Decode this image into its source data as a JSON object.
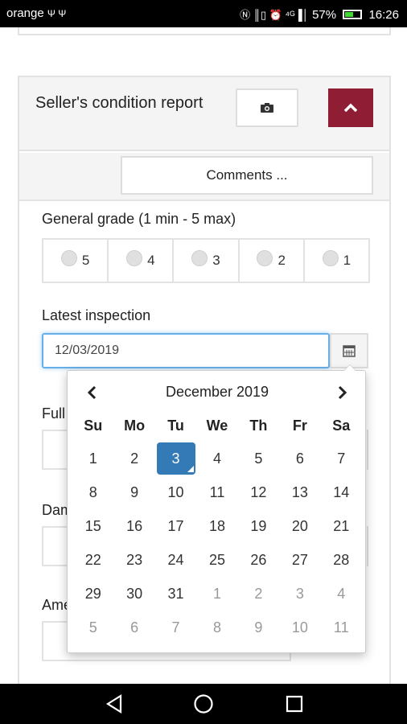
{
  "status_bar": {
    "carrier": "orange",
    "carrier_icons": "Ψ Ψ",
    "system_icons": "Ⓝ ║▯ ⏰ ⁴ᴳ▐│",
    "battery": "57%",
    "time": "16:26"
  },
  "panel": {
    "title": "Seller's condition report",
    "camera_button_icon": "camera-icon",
    "collapse_button_icon": "chevron-up-icon",
    "accent_color": "#8f1d33",
    "comments_label": "Comments ..."
  },
  "grade": {
    "label": "General grade (1 min - 5 max)",
    "options": [
      "5",
      "4",
      "3",
      "2",
      "1"
    ]
  },
  "inspection": {
    "label": "Latest inspection",
    "value": "12/03/2019"
  },
  "hidden_labels": {
    "a": "Full",
    "b": "Dam",
    "c": "Ame"
  },
  "datepicker": {
    "title": "December 2019",
    "weekdays": [
      "Su",
      "Mo",
      "Tu",
      "We",
      "Th",
      "Fr",
      "Sa"
    ],
    "weeks": [
      [
        "1",
        "2",
        "3",
        "4",
        "5",
        "6",
        "7"
      ],
      [
        "8",
        "9",
        "10",
        "11",
        "12",
        "13",
        "14"
      ],
      [
        "15",
        "16",
        "17",
        "18",
        "19",
        "20",
        "21"
      ],
      [
        "22",
        "23",
        "24",
        "25",
        "26",
        "27",
        "28"
      ],
      [
        "29",
        "30",
        "31",
        "1",
        "2",
        "3",
        "4"
      ],
      [
        "5",
        "6",
        "7",
        "8",
        "9",
        "10",
        "11"
      ]
    ],
    "selected": "3",
    "highlight_color": "#337ab7"
  },
  "nav_bar": {
    "back_icon": "back-icon",
    "home_icon": "home-icon",
    "recents_icon": "recents-icon"
  }
}
